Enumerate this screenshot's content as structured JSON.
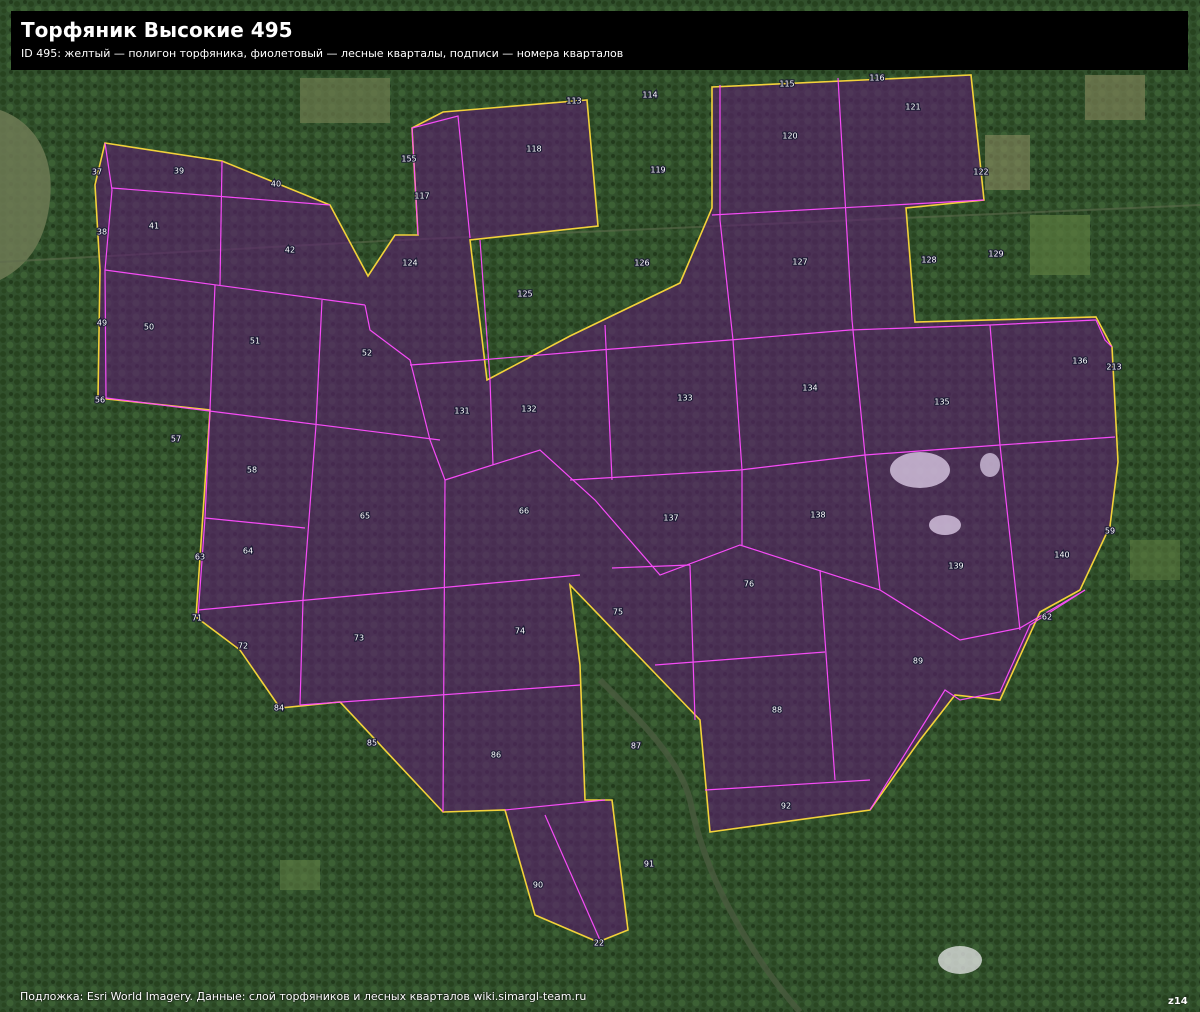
{
  "title": "Торфяник Высокие 495",
  "subtitle": "ID 495: желтый — полигон торфяника, фиолетовый — лесные кварталы, подписи — номера кварталов",
  "credits": "Подложка: Esri World Imagery. Данные: слой торфяников и лесных кварталов wiki.simargl-team.ru",
  "zoom_label": "z14",
  "colors": {
    "peat_outline": "#f2d23a",
    "quarter_line": "#ff4dff",
    "quarter_fill": "#5a1f6e",
    "forest_dark": "#1f3a1c",
    "forest_mid": "#36572f",
    "title_bg": "#000000"
  },
  "quarter_labels": [
    "37",
    "39",
    "40",
    "41",
    "38",
    "42",
    "49",
    "50",
    "51",
    "52",
    "56",
    "57",
    "58",
    "63",
    "64",
    "65",
    "66",
    "71",
    "72",
    "73",
    "74",
    "75",
    "76",
    "84",
    "85",
    "86",
    "87",
    "88",
    "89",
    "90",
    "91",
    "92",
    "113",
    "114",
    "115",
    "116",
    "117",
    "118",
    "119",
    "120",
    "121",
    "122",
    "124",
    "125",
    "126",
    "127",
    "128",
    "129",
    "131",
    "132",
    "133",
    "134",
    "135",
    "136",
    "137",
    "138",
    "139",
    "140",
    "155",
    "213",
    "22",
    "59",
    "62"
  ]
}
